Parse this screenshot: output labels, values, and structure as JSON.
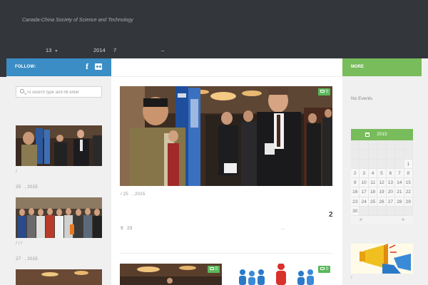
{
  "header": {
    "tagline": "Canada-China Society of Science and Technology",
    "nav": [
      {
        "label": "13"
      },
      {
        "label": "2014"
      },
      {
        "label": "7"
      },
      {
        "label": "–"
      }
    ]
  },
  "sidebar_left": {
    "follow_label": "FOLLOW:",
    "social_icons": [
      "facebook-icon",
      "flickr-icon"
    ],
    "search_placeholder": "To search type and hit enter",
    "posts": [
      {
        "cat": "/",
        "date_day": "25",
        "date_year": ", 2015"
      },
      {
        "cat": "/ / /",
        "date_day": "27",
        "date_year": ", 2015"
      }
    ]
  },
  "main": {
    "featured": {
      "comments": "0",
      "meta_prefix": "/",
      "meta_day": "25",
      "meta_year": ", 2015",
      "format_icon": "2",
      "line_a": "9",
      "line_b": "23",
      "line_c": "..."
    },
    "post2": {
      "comments": "0"
    },
    "post3": {
      "comments": "0"
    }
  },
  "sidebar_right": {
    "more_label": "MORE",
    "no_events": "No Events",
    "calendar": {
      "year": "2015",
      "days": [
        "",
        "",
        "",
        "",
        "",
        "",
        "",
        "",
        "",
        "",
        "",
        "",
        "",
        "",
        "",
        "",
        "",
        "",
        "",
        "",
        "1",
        "2",
        "3",
        "4",
        "5",
        "6",
        "7",
        "8",
        "9",
        "10",
        "11",
        "12",
        "13",
        "14",
        "15",
        "16",
        "17",
        "18",
        "19",
        "20",
        "21",
        "22",
        "23",
        "24",
        "25",
        "26",
        "27",
        "28",
        "29",
        "30",
        "",
        "",
        "",
        "",
        "",
        ""
      ],
      "prev": "«",
      "next": "»"
    }
  },
  "colors": {
    "header_bg": "#33363b",
    "follow_blue": "#3b8dc5",
    "more_green": "#78bc5b",
    "badge_green": "#5cb85c"
  }
}
